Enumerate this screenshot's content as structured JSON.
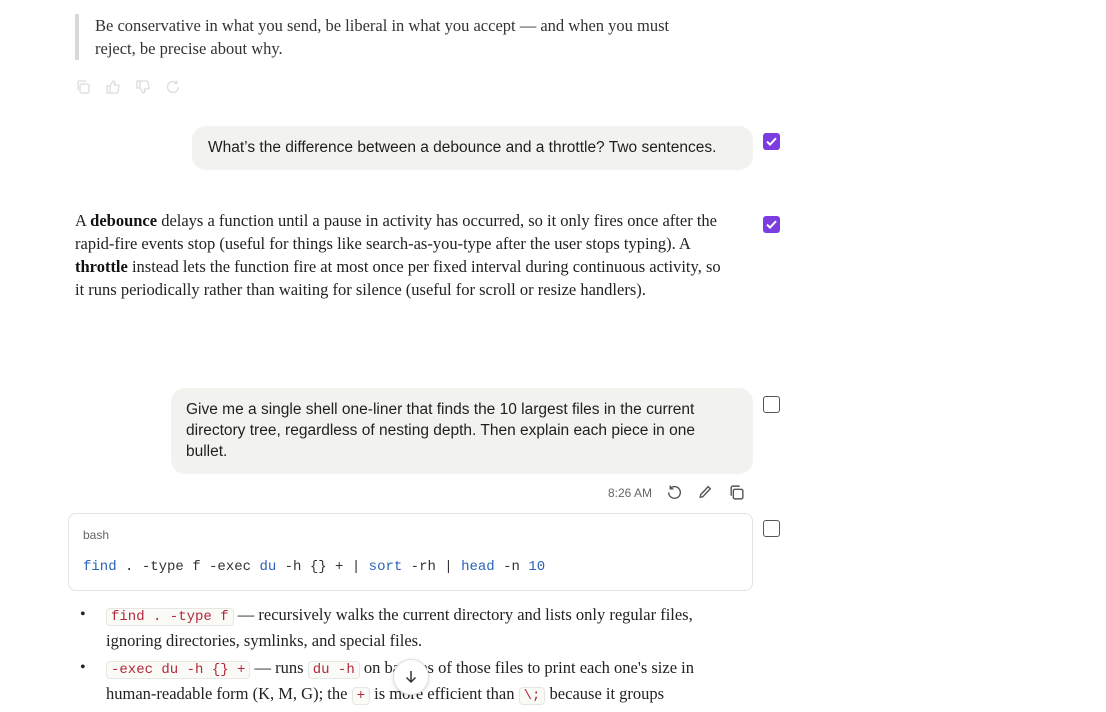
{
  "quote": {
    "text": "Be conservative in what you send, be liberal in what you accept — and when you must reject, be precise about why."
  },
  "quote_actions": [
    "copy-icon",
    "thumbs-up-icon",
    "thumbs-down-icon",
    "retry-icon"
  ],
  "messages": [
    {
      "role": "user",
      "text": "What’s the difference between a debounce and a throttle? Two sentences.",
      "selected": true
    },
    {
      "role": "assistant",
      "selected": true,
      "parts": {
        "p1": "A ",
        "b1": "debounce",
        "p2": " delays a function until a pause in activity has occurred, so it only fires once after the rapid-fire events stop (useful for things like search-as-you-type after the user stops typing). A ",
        "b2": "throttle",
        "p3": " instead lets the function fire at most once per fixed interval during continuous activity, so it runs periodically rather than waiting for silence (useful for scroll or resize handlers)."
      }
    },
    {
      "role": "user",
      "text": "Give me a single shell one-liner that finds the 10 largest files in the current directory tree, regardless of nesting depth. Then explain each piece in one bullet.",
      "selected": false,
      "timestamp": "8:26 AM",
      "actions": [
        "retry-icon",
        "edit-icon",
        "copy-icon"
      ]
    },
    {
      "role": "assistant",
      "selected": false,
      "code": {
        "language": "bash",
        "tokens": [
          "find",
          " . -type f -exec ",
          "du",
          " -h {} + | ",
          "sort",
          " -rh | ",
          "head",
          " -n ",
          "10"
        ]
      },
      "bullets": [
        {
          "code1": "find . -type f",
          "text1": " — recursively walks the current directory and lists only regular files, ignoring directories, symlinks, and special files."
        },
        {
          "code1": "-exec du -h {} +",
          "text1": " — runs ",
          "code2": "du -h",
          "text2": " on batches of those files to print each one's size in human-readable form (K, M, G); the ",
          "code3": "+",
          "text3": " is more efficient than ",
          "code4": "\\;",
          "text4": " because it groups"
        }
      ]
    }
  ],
  "colors": {
    "accent": "#7b3ce0",
    "bubble": "#f2f2ef",
    "code_keyword": "#2a62b8",
    "inline_code": "#b5283c"
  },
  "scroll_button": "arrow-down-icon"
}
